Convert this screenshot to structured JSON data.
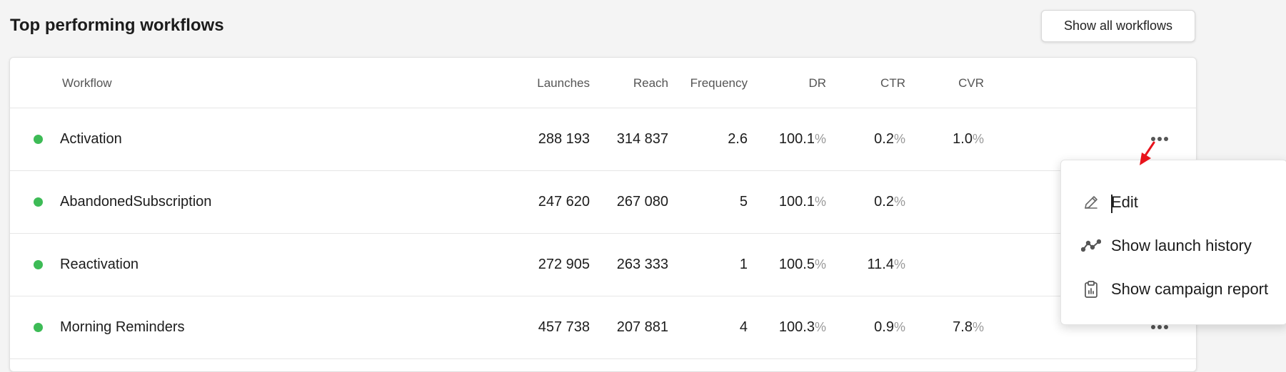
{
  "page": {
    "title": "Top performing workflows",
    "show_all_label": "Show all workflows"
  },
  "table": {
    "columns": [
      "Workflow",
      "Launches",
      "Reach",
      "Frequency",
      "DR",
      "CTR",
      "CVR"
    ],
    "percent_sign": "%",
    "rows": [
      {
        "status": "active",
        "name": "Activation",
        "launches": "288 193",
        "reach": "314 837",
        "frequency": "2.6",
        "dr": "100.1",
        "ctr": "0.2",
        "cvr": "1.0"
      },
      {
        "status": "active",
        "name": "AbandonedSubscription",
        "launches": "247 620",
        "reach": "267 080",
        "frequency": "5",
        "dr": "100.1",
        "ctr": "0.2",
        "cvr": ""
      },
      {
        "status": "active",
        "name": "Reactivation",
        "launches": "272 905",
        "reach": "263 333",
        "frequency": "1",
        "dr": "100.5",
        "ctr": "11.4",
        "cvr": ""
      },
      {
        "status": "active",
        "name": "Morning Reminders",
        "launches": "457 738",
        "reach": "207 881",
        "frequency": "4",
        "dr": "100.3",
        "ctr": "0.9",
        "cvr": "7.8"
      }
    ]
  },
  "context_menu": {
    "items": [
      {
        "label": "Edit",
        "icon": "pencil-icon"
      },
      {
        "label": "Show launch history",
        "icon": "line-chart-icon"
      },
      {
        "label": "Show campaign report",
        "icon": "clipboard-report-icon"
      }
    ]
  },
  "colors": {
    "status_active": "#3dbb56",
    "annotation_arrow": "#e8141c"
  }
}
